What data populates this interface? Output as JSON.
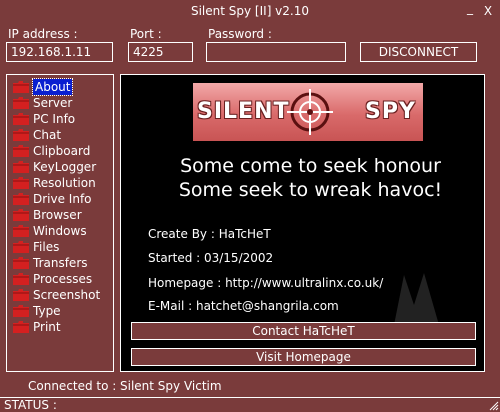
{
  "window": {
    "title": "Silent Spy [II] v2.10",
    "minimize": "_",
    "close": "X"
  },
  "connection": {
    "ip_label": "IP address :",
    "ip_value": "192.168.1.11",
    "port_label": "Port :",
    "port_value": "4225",
    "password_label": "Password :",
    "password_value": "",
    "disconnect_label": "DISCONNECT"
  },
  "sidebar": {
    "selected": "About",
    "items": [
      {
        "label": "About"
      },
      {
        "label": "Server"
      },
      {
        "label": "PC Info"
      },
      {
        "label": "Chat"
      },
      {
        "label": "Clipboard"
      },
      {
        "label": "KeyLogger"
      },
      {
        "label": "Resolution"
      },
      {
        "label": "Drive Info"
      },
      {
        "label": "Browser"
      },
      {
        "label": "Windows"
      },
      {
        "label": "Files"
      },
      {
        "label": "Transfers"
      },
      {
        "label": "Processes"
      },
      {
        "label": "Screenshot"
      },
      {
        "label": "Type"
      },
      {
        "label": "Print"
      }
    ]
  },
  "about": {
    "logo_left": "SILENT",
    "logo_right": "SPY",
    "slogan_line1": "Some come to seek honour",
    "slogan_line2": "Some seek to wreak havoc!",
    "created_by": "Create By : HaTcHeT",
    "started": "Started : 03/15/2002",
    "homepage": "Homepage : http://www.ultralinx.co.uk/",
    "email": "E-Mail : hatchet@shangrila.com",
    "contact_button": "Contact HaTcHeT",
    "visit_button": "Visit Homepage"
  },
  "footer": {
    "connected_label": "Connected to :",
    "connected_value": "Silent Spy Victim",
    "status_label": "STATUS :"
  },
  "colors": {
    "background": "#7a3b3b",
    "panel": "#000000",
    "selection": "#0a1fd0",
    "folder": "#d42020"
  }
}
